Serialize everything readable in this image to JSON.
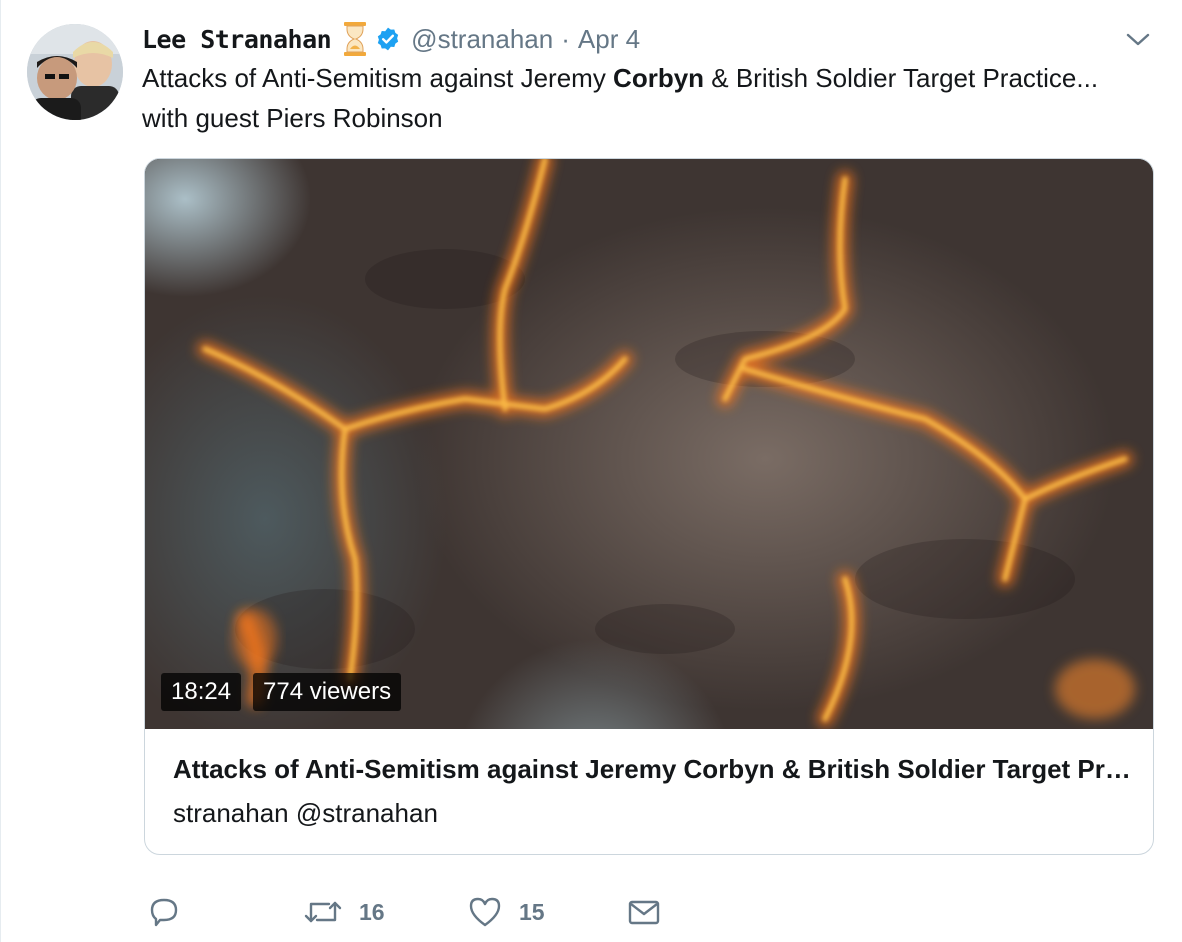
{
  "tweet": {
    "name": "Lee Stranahan",
    "handle": "@stranahan",
    "separator": "·",
    "date": "Apr 4",
    "text_before": "Attacks of Anti-Semitism against Jeremy ",
    "text_bold": "Corbyn",
    "text_after": " & British Soldier Target Practice... with guest Piers Robinson"
  },
  "card": {
    "duration": "18:24",
    "viewers": "774 viewers",
    "title": "Attacks of Anti-Semitism against Jeremy Corbyn & British Soldier Target Practice... with guest Piers Robinson",
    "subtitle": "stranahan @stranahan"
  },
  "actions": {
    "retweets": "16",
    "likes": "15"
  },
  "icons": {
    "emoji": "hourglass-icon",
    "verified": "verified-badge-icon",
    "caret": "chevron-down-icon",
    "reply": "reply-icon",
    "retweet": "retweet-icon",
    "like": "heart-icon",
    "dm": "envelope-icon"
  },
  "colors": {
    "text": "#14171a",
    "muted": "#657786",
    "verified": "#1da1f2",
    "border": "#ccd6dd"
  }
}
